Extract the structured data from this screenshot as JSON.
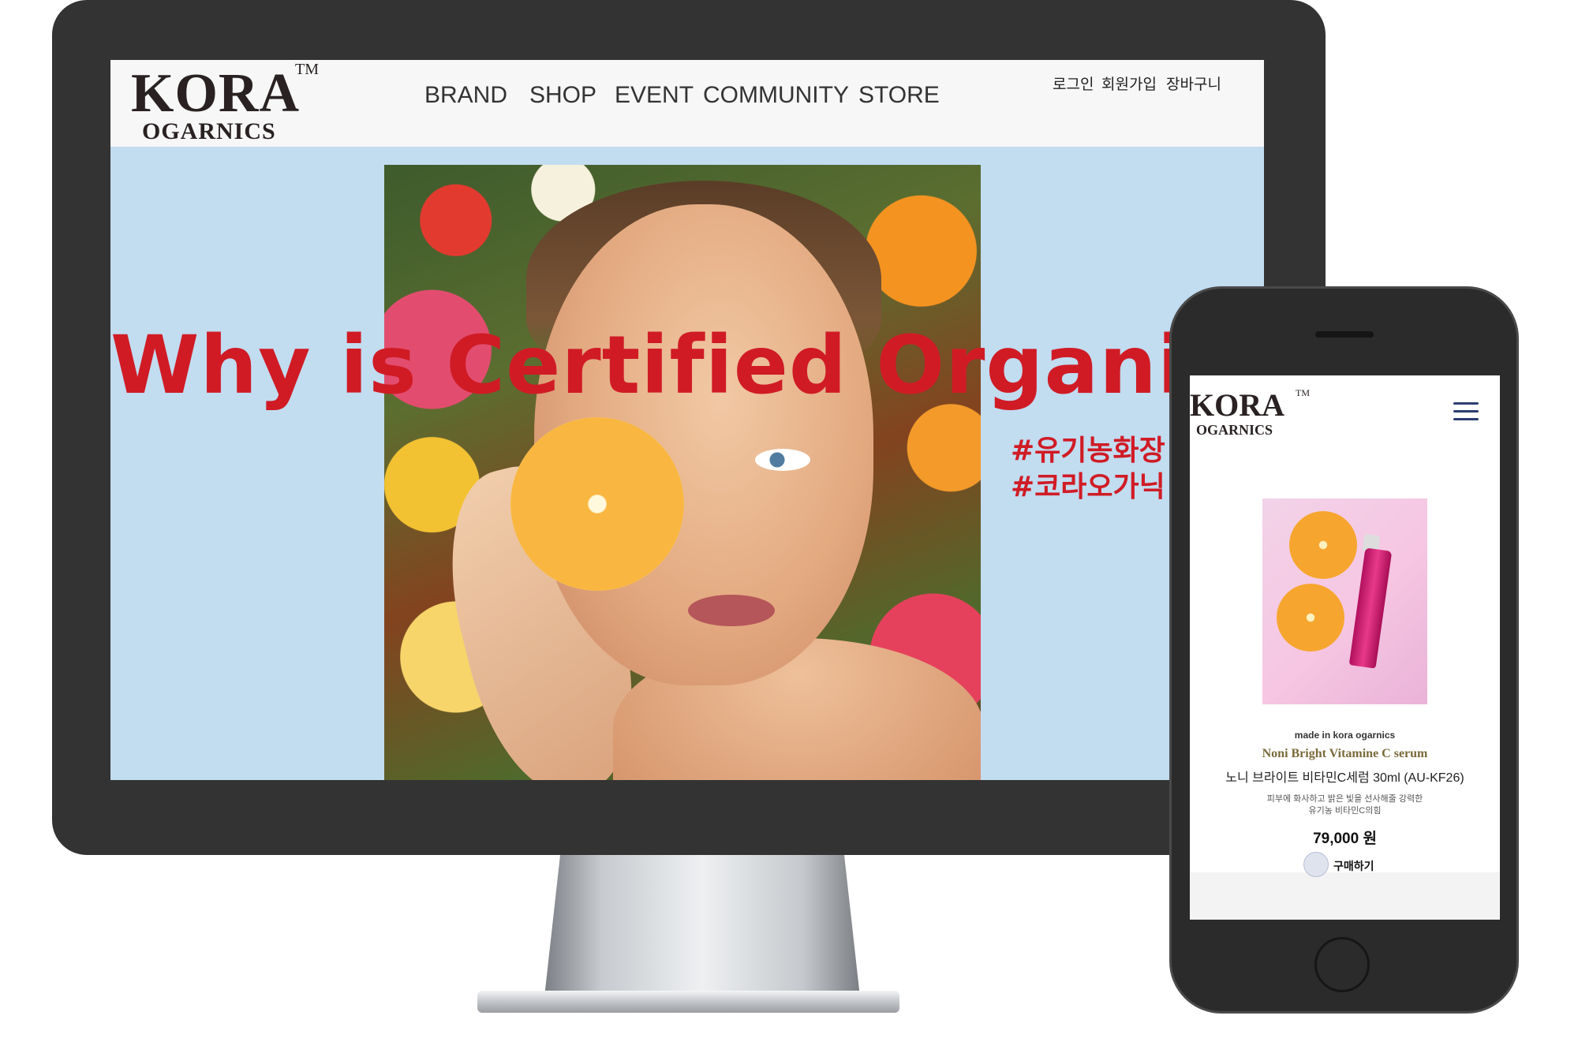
{
  "desktop": {
    "logo": {
      "main": "KORA",
      "tm": "TM",
      "sub": "OGARNICS"
    },
    "nav": [
      "BRAND",
      "SHOP",
      "EVENT",
      "COMMUNITY",
      "STORE"
    ],
    "utility": [
      "로그인",
      "회원가입",
      "장바구니"
    ],
    "hero": {
      "headline": "Why is Certified Organi",
      "tags": [
        "#유기농화장",
        "#코라오가닉"
      ]
    }
  },
  "mobile": {
    "logo": {
      "main": "KORA",
      "tm": "TM",
      "sub": "OGARNICS"
    },
    "product": {
      "made_in": "made in kora ogarnics",
      "name_en": "Noni Bright Vitamine C serum",
      "name_ko": "노니 브라이트 비타민C세럼 30ml (AU-KF26)",
      "description": [
        "피부에 화사하고 밝은 빛을 선사해줄 강력한",
        "유기농 비타민C의힘"
      ],
      "price": "79,000 원",
      "buy_label": "구매하기"
    }
  },
  "icons": {
    "menu": "hamburger-menu-icon",
    "buy": "shopping-basket-icon"
  },
  "colors": {
    "headline": "#d01b25",
    "hero_background": "#c2dcf0",
    "device_frame": "#333333",
    "menu_icon": "#2c3e70"
  }
}
